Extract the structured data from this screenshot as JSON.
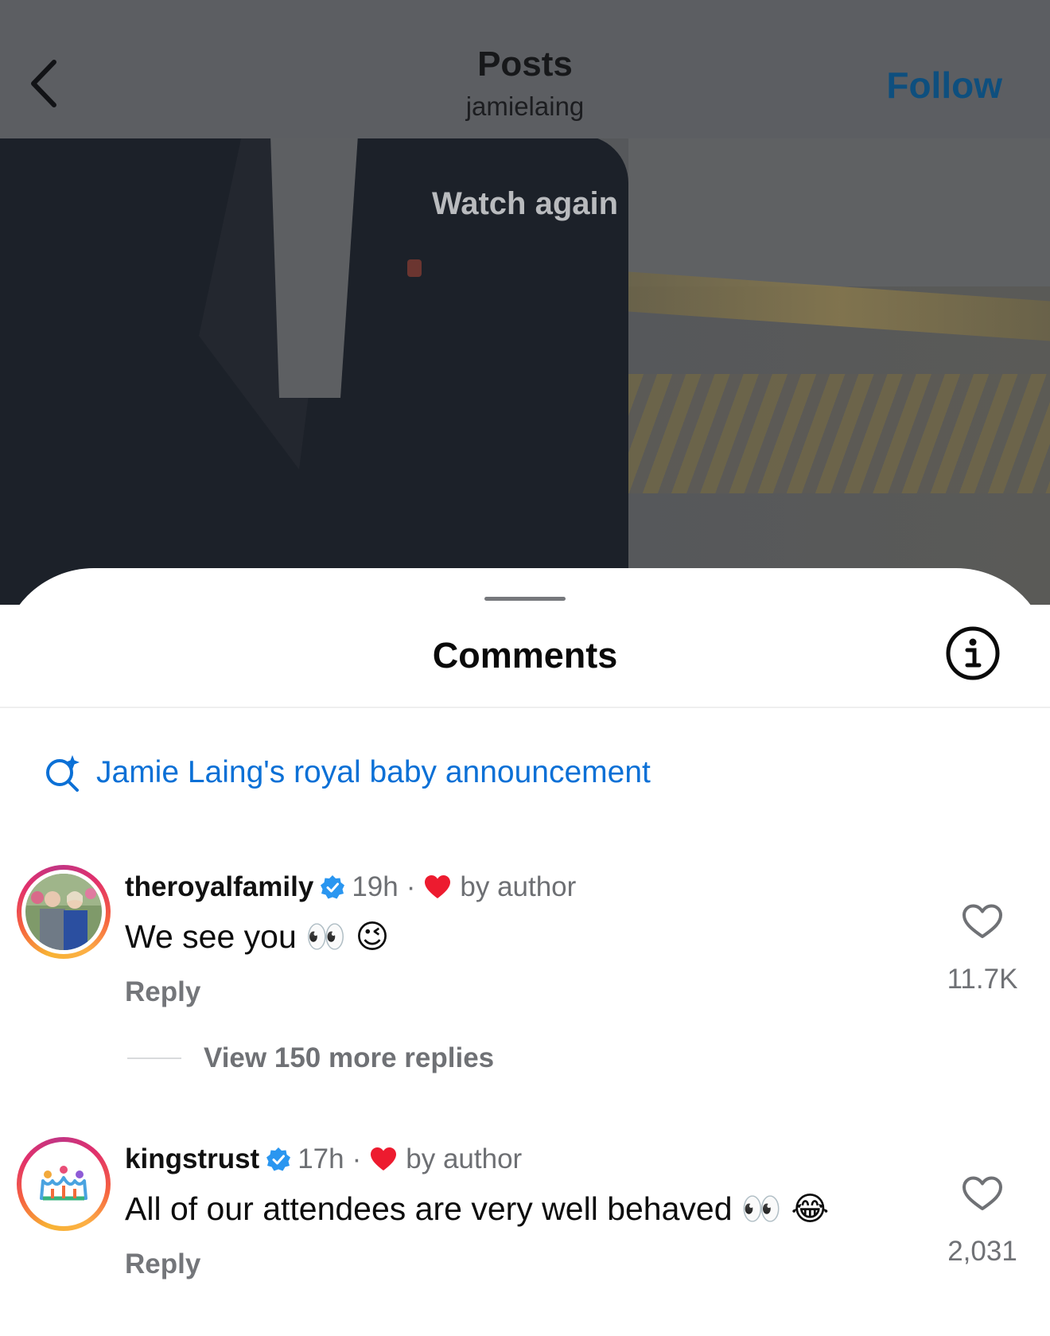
{
  "header": {
    "title": "Posts",
    "subtitle": "jamielaing",
    "follow_label": "Follow",
    "back_icon": "chevron-left-icon"
  },
  "video": {
    "overlay_text": "Watch again"
  },
  "sheet": {
    "title": "Comments",
    "info_icon": "info-circle-icon",
    "search_suggestion": "Jamie Laing's royal baby announcement"
  },
  "comments": [
    {
      "username": "theroyalfamily",
      "verified": true,
      "time": "19h",
      "liked_by_author": "by author",
      "text": "We see you 👀 😉",
      "reply_label": "Reply",
      "like_count": "11.7K",
      "view_more_replies": "View 150 more replies"
    },
    {
      "username": "kingstrust",
      "verified": true,
      "time": "17h",
      "liked_by_author": "by author",
      "text": "All of our attendees are very well behaved 👀 😂",
      "reply_label": "Reply",
      "like_count": "2,031"
    }
  ],
  "colors": {
    "link_blue": "#0b70d6",
    "follow_blue": "#0e4f7e",
    "heart_red": "#ed1b2f",
    "verified_blue": "#2a96f0"
  }
}
